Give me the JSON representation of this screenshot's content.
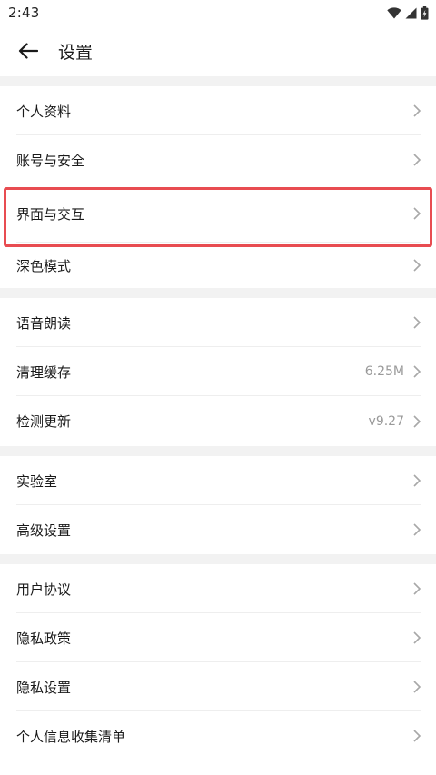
{
  "status_bar": {
    "time": "2:43"
  },
  "header": {
    "title": "设置"
  },
  "groups": [
    {
      "items": [
        {
          "label": "个人资料",
          "value": ""
        },
        {
          "label": "账号与安全",
          "value": ""
        },
        {
          "label": "界面与交互",
          "value": ""
        },
        {
          "label": "深色模式",
          "value": ""
        }
      ]
    },
    {
      "items": [
        {
          "label": "语音朗读",
          "value": ""
        },
        {
          "label": "清理缓存",
          "value": "6.25M"
        },
        {
          "label": "检测更新",
          "value": "v9.27"
        }
      ]
    },
    {
      "items": [
        {
          "label": "实验室",
          "value": ""
        },
        {
          "label": "高级设置",
          "value": ""
        }
      ]
    },
    {
      "items": [
        {
          "label": "用户协议",
          "value": ""
        },
        {
          "label": "隐私政策",
          "value": ""
        },
        {
          "label": "隐私设置",
          "value": ""
        },
        {
          "label": "个人信息收集清单",
          "value": ""
        }
      ]
    }
  ],
  "highlight": {
    "target": "界面与交互",
    "color": "#e84c51"
  }
}
